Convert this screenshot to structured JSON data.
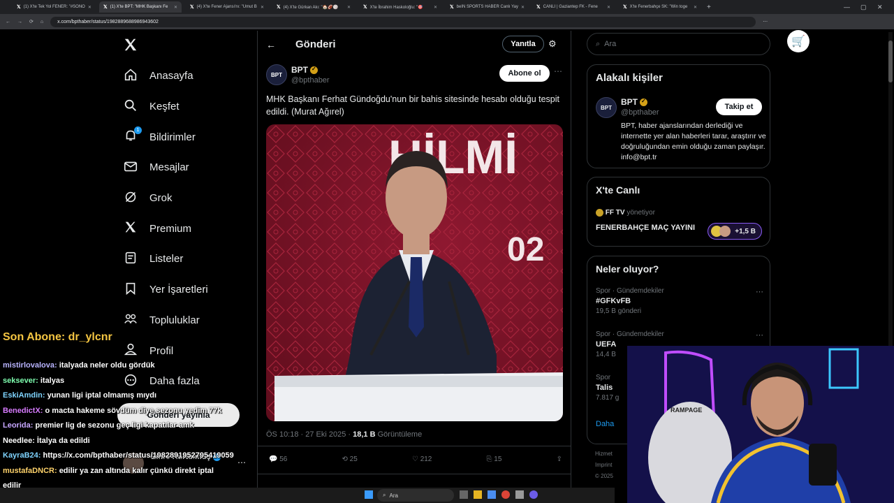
{
  "browser": {
    "tabs": [
      {
        "title": "(1) X'te Tek Yol FENER: \"#SONO",
        "active": false
      },
      {
        "title": "(1) X'te BPT: \"MHK Başkanı Fe",
        "active": true
      },
      {
        "title": "(4) X'te Fener Ajansı'nı: \"Umut B",
        "active": false
      },
      {
        "title": "(4) X'te Gürkan Akı: \"🏠🏈🏐",
        "active": false
      },
      {
        "title": "X'te İbrahim Haskoloğlu: \"🎯",
        "active": false
      },
      {
        "title": "beIN SPORTS HABER Canlı Yay",
        "active": false
      },
      {
        "title": "CANLI | Gaziantep FK - Fene",
        "active": false
      },
      {
        "title": "X'te Fenerbahçe SK: \"Win toge",
        "active": false
      }
    ],
    "url": "x.com/bpthaber/status/1982889688986943602"
  },
  "sidebar": {
    "items": [
      {
        "label": "Anasayfa",
        "icon": "home-icon"
      },
      {
        "label": "Keşfet",
        "icon": "search-icon"
      },
      {
        "label": "Bildirimler",
        "icon": "bell-icon"
      },
      {
        "label": "Mesajlar",
        "icon": "mail-icon"
      },
      {
        "label": "Grok",
        "icon": "grok-icon"
      },
      {
        "label": "Premium",
        "icon": "x-icon"
      },
      {
        "label": "Listeler",
        "icon": "list-icon"
      },
      {
        "label": "Yer İşaretleri",
        "icon": "bookmark-icon"
      },
      {
        "label": "Topluluklar",
        "icon": "communities-icon"
      },
      {
        "label": "Profil",
        "icon": "person-icon"
      },
      {
        "label": "Daha fazla",
        "icon": "more-circle-icon"
      }
    ],
    "notification_badge": "1",
    "post_button": "Gönderi yayınla",
    "account": {
      "name": "Emre Kurtulmuş"
    }
  },
  "post": {
    "header_title": "Gönderi",
    "reply_button": "Yanıtla",
    "author_name": "BPT",
    "author_handle": "@bpthaber",
    "follow_button": "Abone ol",
    "avatar_text": "BPT",
    "text": "MHK Başkanı Ferhat Gündoğdu'nun bir bahis sitesinde hesabı olduğu tespit edildi. (Murat Ağırel)",
    "image_text": {
      "backdrop": "HİLMİ",
      "number": "02"
    },
    "timestamp": "ÖS 10:18 · 27 Eki 2025 · ",
    "views_count": "18,1 B",
    "views_label": " Görüntüleme",
    "stats": {
      "replies": "56",
      "reposts": "25",
      "likes": "212",
      "bookmarks": "15"
    }
  },
  "right": {
    "search_placeholder": "Ara",
    "related": {
      "title": "Alakalı kişiler",
      "name": "BPT",
      "handle": "@bpthaber",
      "follow": "Takip et",
      "bio": "BPT, haber ajanslarından derlediği ve internette yer alan haberleri tarar, araştırır ve doğruluğundan emin olduğu zaman paylaşır. info@bpt.tr"
    },
    "live": {
      "title": "X'te Canlı",
      "host": "FF TV",
      "host_role": " yönetiyor",
      "stream_title": "FENERBAHÇE MAÇ YAYINI",
      "listeners": "+1,5 B"
    },
    "trends": {
      "title": "Neler oluyor?",
      "items": [
        {
          "meta": "Spor · Gündemdekiler",
          "name": "#GFKvFB",
          "count": "19,5 B gönderi"
        },
        {
          "meta": "Spor · Gündemdekiler",
          "name": "UEFA",
          "count": "14,4 B"
        },
        {
          "meta": "Spor",
          "name": "Talis",
          "count": "7.817 g"
        }
      ],
      "show_more": "Daha"
    },
    "footer": [
      "Hizmet",
      "Imprint",
      "© 2025"
    ]
  },
  "overlay": {
    "last_sub": "Son Abone: dr_ylcnr",
    "chat": [
      {
        "user": "mistirlovalova:",
        "msg": "italyada neler oldu gördük",
        "color": "#b9b4ff"
      },
      {
        "user": "seksever:",
        "msg": "italyas",
        "color": "#7fffb0"
      },
      {
        "user": "EskiAmdin:",
        "msg": "yunan ligi iptal olmamış mıydı",
        "color": "#7fd4ff"
      },
      {
        "user": "BenedictX:",
        "msg": "o macta hakeme sövdüm diye sezonu yedim 77k",
        "color": "#d87cff"
      },
      {
        "user": "Leorida:",
        "msg": "premier lig de sezonu geç ligi kapatılar amk",
        "color": "#c7a7ff"
      },
      {
        "user": "Needlee:",
        "msg": "İtalya da edildi",
        "color": "#ffffff"
      },
      {
        "user": "KayraB24:",
        "msg": "https://x.com/bpthaber/status/1982891952795419059",
        "color": "#7fd4ff"
      },
      {
        "user": "mustafaDNCR:",
        "msg": "edilir ya zan altında kalır çünkü direkt iptal",
        "color": "#ffd36b"
      },
      {
        "user": "",
        "msg": "edilir",
        "color": "#ffffff"
      }
    ]
  },
  "taskbar": {
    "search_placeholder": "Ara"
  },
  "colors": {
    "bg": "#000000",
    "border": "#2f3336",
    "muted": "#71767b",
    "accent": "#1d9bf0",
    "sub_color": "#f4c542"
  }
}
